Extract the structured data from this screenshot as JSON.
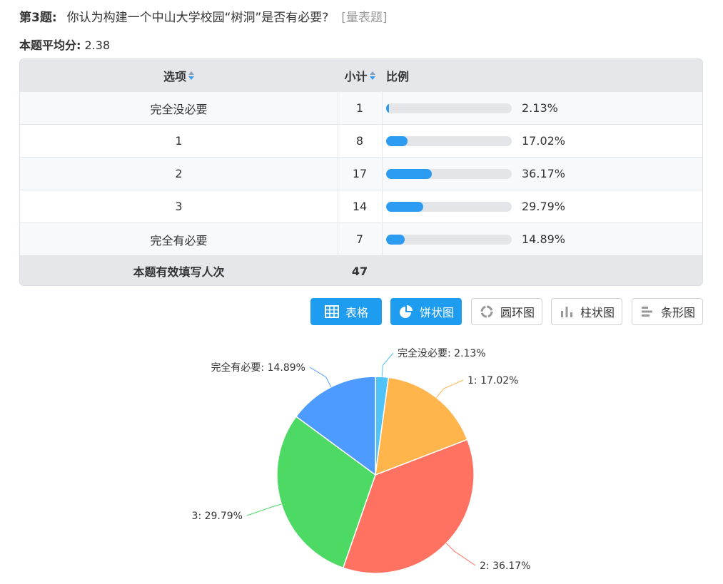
{
  "question": {
    "number": "第3题:",
    "text": "你认为构建一个中山大学校园“树洞”是否有必要?",
    "type_tag": "[量表题]"
  },
  "average": {
    "label": "本题平均分:",
    "value": "2.38"
  },
  "table": {
    "headers": {
      "option": "选项",
      "count": "小计",
      "ratio": "比例"
    },
    "rows": [
      {
        "option": "完全没必要",
        "count": "1",
        "percent": "2.13%",
        "fraction": 0.0213
      },
      {
        "option": "1",
        "count": "8",
        "percent": "17.02%",
        "fraction": 0.1702
      },
      {
        "option": "2",
        "count": "17",
        "percent": "36.17%",
        "fraction": 0.3617
      },
      {
        "option": "3",
        "count": "14",
        "percent": "29.79%",
        "fraction": 0.2979
      },
      {
        "option": "完全有必要",
        "count": "7",
        "percent": "14.89%",
        "fraction": 0.1489
      }
    ],
    "footer": {
      "label": "本题有效填写人次",
      "total": "47"
    }
  },
  "chart_buttons": [
    {
      "label": "表格",
      "icon": "table-icon",
      "active": true
    },
    {
      "label": "饼状图",
      "icon": "pie-chart-icon",
      "active": true
    },
    {
      "label": "圆环图",
      "icon": "donut-chart-icon",
      "active": false
    },
    {
      "label": "柱状图",
      "icon": "bar-chart-icon",
      "active": false
    },
    {
      "label": "条形图",
      "icon": "horizontal-bar-chart-icon",
      "active": false
    }
  ],
  "colors": {
    "accent": "#1e9cf0",
    "bar_fill": "#2b9cf2"
  },
  "chart_data": {
    "type": "pie",
    "slices": [
      {
        "label": "完全没必要",
        "value": 2.13,
        "display": "完全没必要: 2.13%",
        "color": "#4fc3f7"
      },
      {
        "label": "1",
        "value": 17.02,
        "display": "1: 17.02%",
        "color": "#ffb54c"
      },
      {
        "label": "2",
        "value": 36.17,
        "display": "2: 36.17%",
        "color": "#ff7262"
      },
      {
        "label": "3",
        "value": 29.79,
        "display": "3: 29.79%",
        "color": "#4cd964"
      },
      {
        "label": "完全有必要",
        "value": 14.89,
        "display": "完全有必要: 14.89%",
        "color": "#4e9bff"
      }
    ]
  }
}
